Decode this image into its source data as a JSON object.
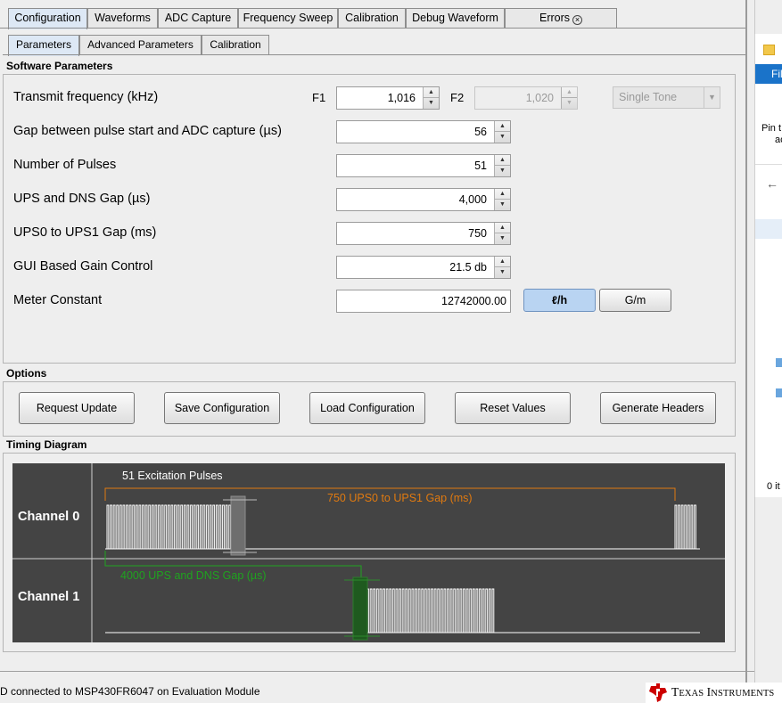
{
  "top_tabs": [
    {
      "label": "Configuration"
    },
    {
      "label": "Waveforms"
    },
    {
      "label": "ADC Capture"
    },
    {
      "label": "Frequency Sweep"
    },
    {
      "label": "Calibration"
    },
    {
      "label": "Debug Waveform"
    },
    {
      "label": "Errors"
    }
  ],
  "sub_tabs": [
    {
      "label": "Parameters"
    },
    {
      "label": "Advanced Parameters"
    },
    {
      "label": "Calibration"
    }
  ],
  "software_parameters": {
    "title": "Software Parameters",
    "transmit_frequency": {
      "label": "Transmit frequency (kHz)",
      "f1_label": "F1",
      "f1_value": "1,016",
      "f2_label": "F2",
      "f2_value": "1,020",
      "mode": "Single Tone"
    },
    "gap_adc": {
      "label": "Gap between pulse start and ADC capture (µs)",
      "value": "56"
    },
    "num_pulses": {
      "label": "Number of Pulses",
      "value": "51"
    },
    "ups_dns_gap": {
      "label": "UPS and DNS Gap (µs)",
      "value": "4,000"
    },
    "ups0_ups1_gap": {
      "label": "UPS0 to UPS1 Gap (ms)",
      "value": "750"
    },
    "gain_control": {
      "label": "GUI Based Gain Control",
      "value": "21.5 db"
    },
    "meter_constant": {
      "label": "Meter Constant",
      "value": "12742000.00",
      "unit_lh": "ℓ/h",
      "unit_gm": "G/m"
    }
  },
  "options": {
    "title": "Options",
    "buttons": [
      "Request Update",
      "Save Configuration",
      "Load Configuration",
      "Reset Values",
      "Generate Headers"
    ]
  },
  "timing": {
    "title": "Timing Diagram",
    "channel0_label": "Channel 0",
    "channel1_label": "Channel 1",
    "excitation_text": "51 Excitation Pulses",
    "ups0_ups1_text": "750 UPS0 to UPS1 Gap (ms)",
    "ups_dns_text": "4000 UPS and DNS Gap (µs)",
    "colors": {
      "background": "#444444",
      "ups_gap": "#e07a10",
      "dns_gap": "#1fa31f",
      "pulse": "#ffffff"
    }
  },
  "status": {
    "connection": "D connected to MSP430FR6047 on Evaluation Module",
    "brand": "Texas Instruments"
  },
  "side_window": {
    "menu_fragment": "Fil",
    "pin_line1": "Pin t",
    "pin_line2": "ac",
    "items_fragment": "0 it"
  }
}
